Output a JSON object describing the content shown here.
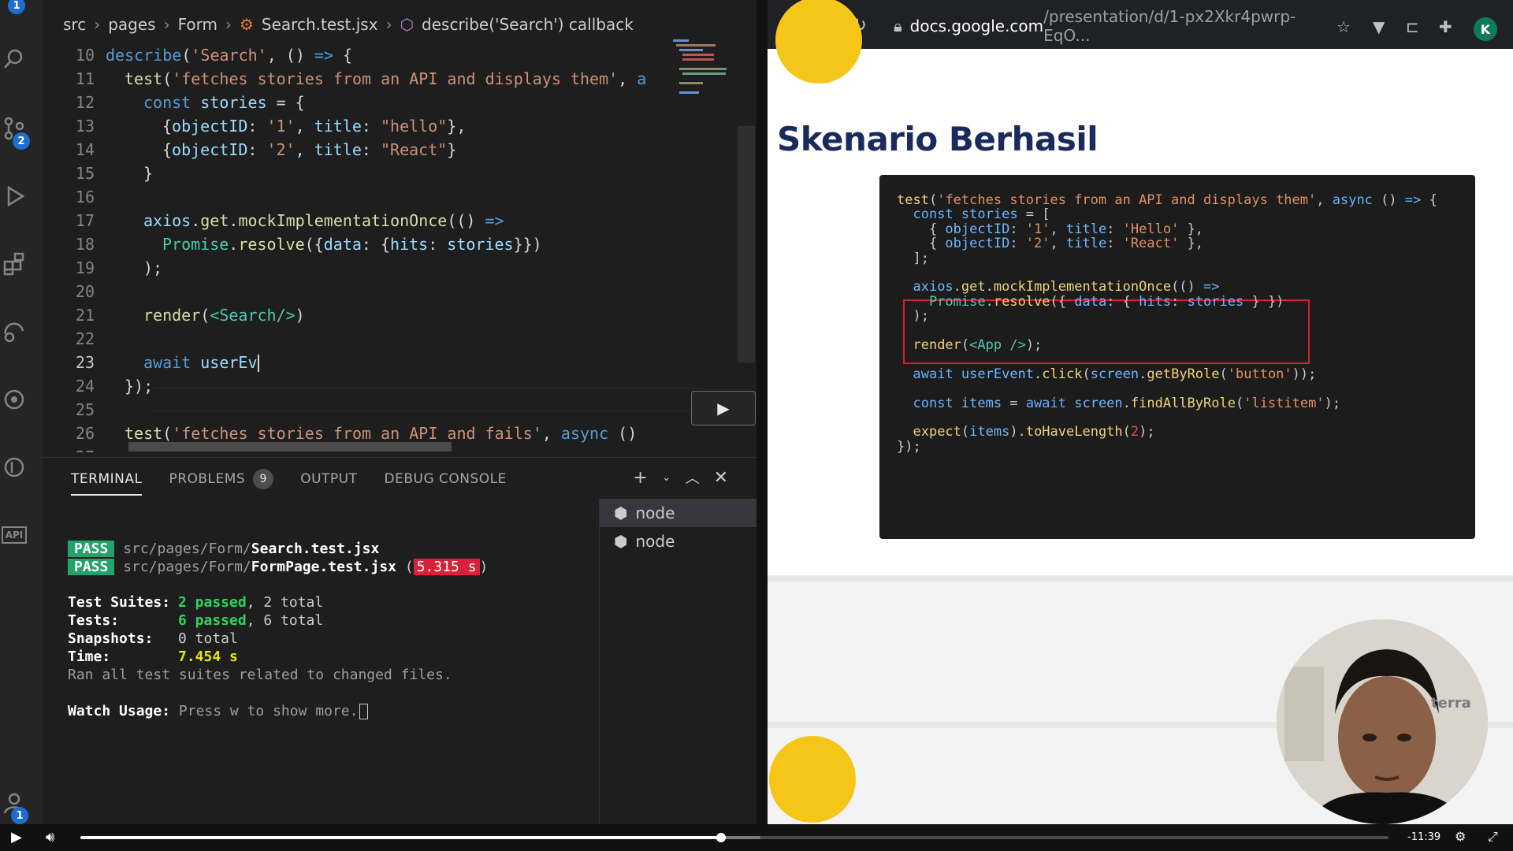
{
  "activity_bar": {
    "scm_badge": "2",
    "top_badge": "1",
    "account_badge": "1",
    "api_label": "API"
  },
  "breadcrumb": {
    "items": [
      "src",
      "pages",
      "Form",
      "Search.test.jsx",
      "describe('Search') callback"
    ]
  },
  "editor": {
    "lines": [
      {
        "n": "10",
        "tokens": [
          [
            "k",
            "describe"
          ],
          [
            "p",
            "("
          ],
          [
            "s",
            "'Search'"
          ],
          [
            "p",
            ", () "
          ],
          [
            "k",
            "=>"
          ],
          [
            "p",
            " {"
          ]
        ],
        "indent": 0
      },
      {
        "n": "11",
        "tokens": [
          [
            "f",
            "test"
          ],
          [
            "p",
            "("
          ],
          [
            "s",
            "'fetches stories from an API and displays them'"
          ],
          [
            "p",
            ", "
          ],
          [
            "k",
            "a"
          ]
        ],
        "indent": 1
      },
      {
        "n": "12",
        "tokens": [
          [
            "k",
            "const "
          ],
          [
            "v",
            "stories"
          ],
          [
            "p",
            " = {"
          ]
        ],
        "indent": 2
      },
      {
        "n": "13",
        "tokens": [
          [
            "p",
            "{"
          ],
          [
            "v",
            "objectID"
          ],
          [
            "p",
            ": "
          ],
          [
            "s",
            "'1'"
          ],
          [
            "p",
            ", "
          ],
          [
            "v",
            "title"
          ],
          [
            "p",
            ": "
          ],
          [
            "s",
            "\"hello\""
          ],
          [
            "p",
            "},"
          ]
        ],
        "indent": 3
      },
      {
        "n": "14",
        "tokens": [
          [
            "p",
            "{"
          ],
          [
            "v",
            "objectID"
          ],
          [
            "p",
            ": "
          ],
          [
            "s",
            "'2'"
          ],
          [
            "p",
            ", "
          ],
          [
            "v",
            "title"
          ],
          [
            "p",
            ": "
          ],
          [
            "s",
            "\"React\""
          ],
          [
            "p",
            "}"
          ]
        ],
        "indent": 3
      },
      {
        "n": "15",
        "tokens": [
          [
            "p",
            "}"
          ]
        ],
        "indent": 2
      },
      {
        "n": "16",
        "tokens": [],
        "indent": 0
      },
      {
        "n": "17",
        "tokens": [
          [
            "v",
            "axios"
          ],
          [
            "p",
            "."
          ],
          [
            "f",
            "get"
          ],
          [
            "p",
            "."
          ],
          [
            "f",
            "mockImplementationOnce"
          ],
          [
            "p",
            "(() "
          ],
          [
            "k",
            "=>"
          ]
        ],
        "indent": 2
      },
      {
        "n": "18",
        "tokens": [
          [
            "c4",
            "Promise"
          ],
          [
            "p",
            "."
          ],
          [
            "f",
            "resolve"
          ],
          [
            "p",
            "({"
          ],
          [
            "v",
            "data"
          ],
          [
            "p",
            ": {"
          ],
          [
            "v",
            "hits"
          ],
          [
            "p",
            ": "
          ],
          [
            "v",
            "stories"
          ],
          [
            "p",
            "}})"
          ]
        ],
        "indent": 3
      },
      {
        "n": "19",
        "tokens": [
          [
            "p",
            ");"
          ]
        ],
        "indent": 2
      },
      {
        "n": "20",
        "tokens": [],
        "indent": 0
      },
      {
        "n": "21",
        "tokens": [
          [
            "f",
            "render"
          ],
          [
            "p",
            "("
          ],
          [
            "c4",
            "<Search/>"
          ],
          [
            "p",
            ")"
          ]
        ],
        "indent": 2
      },
      {
        "n": "22",
        "tokens": [],
        "indent": 0
      },
      {
        "n": "23",
        "tokens": [
          [
            "k",
            "await "
          ],
          [
            "v",
            "userEv"
          ]
        ],
        "indent": 2,
        "active": true
      },
      {
        "n": "24",
        "tokens": [
          [
            "p",
            "});"
          ]
        ],
        "indent": 1
      },
      {
        "n": "25",
        "tokens": [],
        "indent": 0
      },
      {
        "n": "26",
        "tokens": [
          [
            "f",
            "test"
          ],
          [
            "p",
            "("
          ],
          [
            "s",
            "'fetches stories from an API and fails'"
          ],
          [
            "p",
            ", "
          ],
          [
            "k",
            "async"
          ],
          [
            "p",
            " ()"
          ]
        ],
        "indent": 1
      },
      {
        "n": "27",
        "tokens": [],
        "indent": 0
      }
    ]
  },
  "panel": {
    "tabs": [
      {
        "label": "TERMINAL",
        "active": true
      },
      {
        "label": "PROBLEMS",
        "badge": "9"
      },
      {
        "label": "OUTPUT"
      },
      {
        "label": "DEBUG CONSOLE"
      }
    ],
    "terminal": {
      "pass_label": "PASS",
      "file1_dir": "src/pages/Form/",
      "file1_name": "Search.test.jsx",
      "file2_dir": "src/pages/Form/",
      "file2_name": "FormPage.test.jsx",
      "file2_time": "5.315 s",
      "suites_label": "Test Suites:",
      "suites_passed": "2 passed",
      "suites_total": ", 2 total",
      "tests_label": "Tests:",
      "tests_passed": "6 passed",
      "tests_total": ", 6 total",
      "snap_label": "Snapshots:",
      "snap_value": "0 total",
      "time_label": "Time:",
      "time_value": "7.454 s",
      "ran_all": "Ran all test suites related to changed files.",
      "watch_label": "Watch Usage:",
      "watch_text": "Press w to show more."
    },
    "terminal_list": [
      "node",
      "node"
    ]
  },
  "browser": {
    "url_host": "docs.google.com",
    "url_path": "/presentation/d/1-px2Xkr4pwrp-EqO...",
    "profile_initial": "K"
  },
  "slide": {
    "title": "Skenario Berhasil",
    "code": [
      [
        [
          "cf",
          "test"
        ],
        [
          "cw",
          "("
        ],
        [
          "cs",
          "'fetches stories from an API and displays them'"
        ],
        [
          "cw",
          ", "
        ],
        [
          "ck",
          "async"
        ],
        [
          "cw",
          " () "
        ],
        [
          "ck",
          "=>"
        ],
        [
          "cw",
          " {"
        ]
      ],
      [
        [
          "cw",
          "  "
        ],
        [
          "ck",
          "const "
        ],
        [
          "cv",
          "stories"
        ],
        [
          "cw",
          " = ["
        ]
      ],
      [
        [
          "cw",
          "    { "
        ],
        [
          "cv",
          "objectID"
        ],
        [
          "cw",
          ": "
        ],
        [
          "cs",
          "'1'"
        ],
        [
          "cw",
          ", "
        ],
        [
          "cv",
          "title"
        ],
        [
          "cw",
          ": "
        ],
        [
          "cs",
          "'Hello'"
        ],
        [
          "cw",
          " },"
        ]
      ],
      [
        [
          "cw",
          "    { "
        ],
        [
          "cv",
          "objectID"
        ],
        [
          "cw",
          ": "
        ],
        [
          "cs",
          "'2'"
        ],
        [
          "cw",
          ", "
        ],
        [
          "cv",
          "title"
        ],
        [
          "cw",
          ": "
        ],
        [
          "cs",
          "'React'"
        ],
        [
          "cw",
          " },"
        ]
      ],
      [
        [
          "cw",
          "  ];"
        ]
      ],
      [],
      [
        [
          "cw",
          "  "
        ],
        [
          "cv",
          "axios"
        ],
        [
          "cw",
          "."
        ],
        [
          "cf",
          "get"
        ],
        [
          "cw",
          "."
        ],
        [
          "cf",
          "mockImplementationOnce"
        ],
        [
          "cw",
          "(() "
        ],
        [
          "ck",
          "=>"
        ]
      ],
      [
        [
          "cw",
          "    "
        ],
        [
          "cg",
          "Promise"
        ],
        [
          "cw",
          "."
        ],
        [
          "cf",
          "resolve"
        ],
        [
          "cw",
          "({ "
        ],
        [
          "cv",
          "data"
        ],
        [
          "cw",
          ": { "
        ],
        [
          "cv",
          "hits"
        ],
        [
          "cw",
          ": "
        ],
        [
          "cv",
          "stories"
        ],
        [
          "cw",
          " } })"
        ]
      ],
      [
        [
          "cw",
          "  );"
        ]
      ],
      [],
      [
        [
          "cw",
          "  "
        ],
        [
          "cf",
          "render"
        ],
        [
          "cw",
          "("
        ],
        [
          "cg",
          "<App />"
        ],
        [
          "cw",
          ");"
        ]
      ],
      [],
      [
        [
          "cw",
          "  "
        ],
        [
          "ck",
          "await "
        ],
        [
          "cv",
          "userEvent"
        ],
        [
          "cw",
          "."
        ],
        [
          "cf",
          "click"
        ],
        [
          "cw",
          "("
        ],
        [
          "cv",
          "screen"
        ],
        [
          "cw",
          "."
        ],
        [
          "cf",
          "getByRole"
        ],
        [
          "cw",
          "("
        ],
        [
          "cs",
          "'button'"
        ],
        [
          "cw",
          "));"
        ]
      ],
      [],
      [
        [
          "cw",
          "  "
        ],
        [
          "ck",
          "const "
        ],
        [
          "cv",
          "items"
        ],
        [
          "cw",
          " = "
        ],
        [
          "ck",
          "await "
        ],
        [
          "cv",
          "screen"
        ],
        [
          "cw",
          "."
        ],
        [
          "cf",
          "findAllByRole"
        ],
        [
          "cw",
          "("
        ],
        [
          "cs",
          "'listitem'"
        ],
        [
          "cw",
          ");"
        ]
      ],
      [],
      [
        [
          "cw",
          "  "
        ],
        [
          "cf",
          "expect"
        ],
        [
          "cw",
          "("
        ],
        [
          "cv",
          "items"
        ],
        [
          "cw",
          ")."
        ],
        [
          "cf",
          "toHaveLength"
        ],
        [
          "cw",
          "("
        ],
        [
          "cn",
          "2"
        ],
        [
          "cw",
          ");"
        ]
      ],
      [
        [
          "cw",
          "});"
        ]
      ]
    ]
  },
  "webcam": {
    "logo_text": "terra"
  },
  "player": {
    "time": "-11:39",
    "progress": 0.49,
    "buffered": 0.52
  },
  "colors": {
    "accent": "#1c6fd1",
    "slide_title": "#1a2a5c",
    "slide_yellow": "#f5c518",
    "pass_green": "#23a36a"
  }
}
